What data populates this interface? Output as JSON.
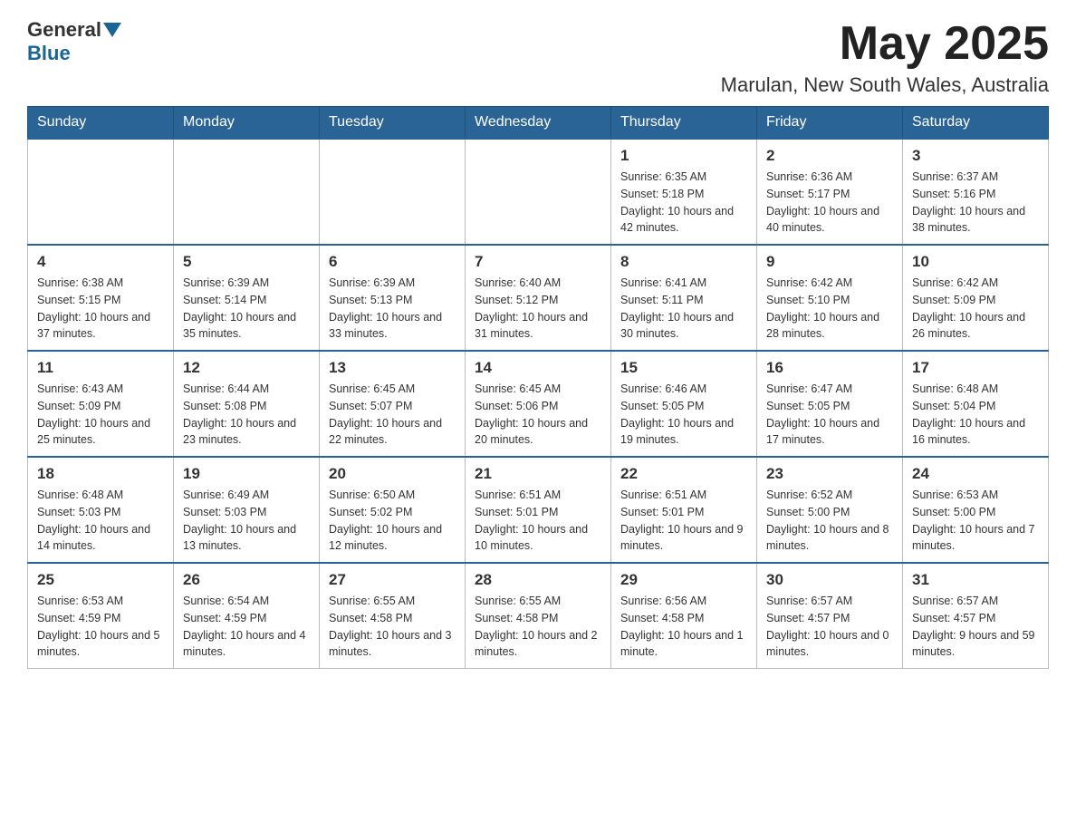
{
  "header": {
    "logo_general": "General",
    "logo_blue": "Blue",
    "month_title": "May 2025",
    "location": "Marulan, New South Wales, Australia"
  },
  "days_of_week": [
    "Sunday",
    "Monday",
    "Tuesday",
    "Wednesday",
    "Thursday",
    "Friday",
    "Saturday"
  ],
  "weeks": [
    {
      "days": [
        {
          "number": "",
          "info": ""
        },
        {
          "number": "",
          "info": ""
        },
        {
          "number": "",
          "info": ""
        },
        {
          "number": "",
          "info": ""
        },
        {
          "number": "1",
          "info": "Sunrise: 6:35 AM\nSunset: 5:18 PM\nDaylight: 10 hours and 42 minutes."
        },
        {
          "number": "2",
          "info": "Sunrise: 6:36 AM\nSunset: 5:17 PM\nDaylight: 10 hours and 40 minutes."
        },
        {
          "number": "3",
          "info": "Sunrise: 6:37 AM\nSunset: 5:16 PM\nDaylight: 10 hours and 38 minutes."
        }
      ]
    },
    {
      "days": [
        {
          "number": "4",
          "info": "Sunrise: 6:38 AM\nSunset: 5:15 PM\nDaylight: 10 hours and 37 minutes."
        },
        {
          "number": "5",
          "info": "Sunrise: 6:39 AM\nSunset: 5:14 PM\nDaylight: 10 hours and 35 minutes."
        },
        {
          "number": "6",
          "info": "Sunrise: 6:39 AM\nSunset: 5:13 PM\nDaylight: 10 hours and 33 minutes."
        },
        {
          "number": "7",
          "info": "Sunrise: 6:40 AM\nSunset: 5:12 PM\nDaylight: 10 hours and 31 minutes."
        },
        {
          "number": "8",
          "info": "Sunrise: 6:41 AM\nSunset: 5:11 PM\nDaylight: 10 hours and 30 minutes."
        },
        {
          "number": "9",
          "info": "Sunrise: 6:42 AM\nSunset: 5:10 PM\nDaylight: 10 hours and 28 minutes."
        },
        {
          "number": "10",
          "info": "Sunrise: 6:42 AM\nSunset: 5:09 PM\nDaylight: 10 hours and 26 minutes."
        }
      ]
    },
    {
      "days": [
        {
          "number": "11",
          "info": "Sunrise: 6:43 AM\nSunset: 5:09 PM\nDaylight: 10 hours and 25 minutes."
        },
        {
          "number": "12",
          "info": "Sunrise: 6:44 AM\nSunset: 5:08 PM\nDaylight: 10 hours and 23 minutes."
        },
        {
          "number": "13",
          "info": "Sunrise: 6:45 AM\nSunset: 5:07 PM\nDaylight: 10 hours and 22 minutes."
        },
        {
          "number": "14",
          "info": "Sunrise: 6:45 AM\nSunset: 5:06 PM\nDaylight: 10 hours and 20 minutes."
        },
        {
          "number": "15",
          "info": "Sunrise: 6:46 AM\nSunset: 5:05 PM\nDaylight: 10 hours and 19 minutes."
        },
        {
          "number": "16",
          "info": "Sunrise: 6:47 AM\nSunset: 5:05 PM\nDaylight: 10 hours and 17 minutes."
        },
        {
          "number": "17",
          "info": "Sunrise: 6:48 AM\nSunset: 5:04 PM\nDaylight: 10 hours and 16 minutes."
        }
      ]
    },
    {
      "days": [
        {
          "number": "18",
          "info": "Sunrise: 6:48 AM\nSunset: 5:03 PM\nDaylight: 10 hours and 14 minutes."
        },
        {
          "number": "19",
          "info": "Sunrise: 6:49 AM\nSunset: 5:03 PM\nDaylight: 10 hours and 13 minutes."
        },
        {
          "number": "20",
          "info": "Sunrise: 6:50 AM\nSunset: 5:02 PM\nDaylight: 10 hours and 12 minutes."
        },
        {
          "number": "21",
          "info": "Sunrise: 6:51 AM\nSunset: 5:01 PM\nDaylight: 10 hours and 10 minutes."
        },
        {
          "number": "22",
          "info": "Sunrise: 6:51 AM\nSunset: 5:01 PM\nDaylight: 10 hours and 9 minutes."
        },
        {
          "number": "23",
          "info": "Sunrise: 6:52 AM\nSunset: 5:00 PM\nDaylight: 10 hours and 8 minutes."
        },
        {
          "number": "24",
          "info": "Sunrise: 6:53 AM\nSunset: 5:00 PM\nDaylight: 10 hours and 7 minutes."
        }
      ]
    },
    {
      "days": [
        {
          "number": "25",
          "info": "Sunrise: 6:53 AM\nSunset: 4:59 PM\nDaylight: 10 hours and 5 minutes."
        },
        {
          "number": "26",
          "info": "Sunrise: 6:54 AM\nSunset: 4:59 PM\nDaylight: 10 hours and 4 minutes."
        },
        {
          "number": "27",
          "info": "Sunrise: 6:55 AM\nSunset: 4:58 PM\nDaylight: 10 hours and 3 minutes."
        },
        {
          "number": "28",
          "info": "Sunrise: 6:55 AM\nSunset: 4:58 PM\nDaylight: 10 hours and 2 minutes."
        },
        {
          "number": "29",
          "info": "Sunrise: 6:56 AM\nSunset: 4:58 PM\nDaylight: 10 hours and 1 minute."
        },
        {
          "number": "30",
          "info": "Sunrise: 6:57 AM\nSunset: 4:57 PM\nDaylight: 10 hours and 0 minutes."
        },
        {
          "number": "31",
          "info": "Sunrise: 6:57 AM\nSunset: 4:57 PM\nDaylight: 9 hours and 59 minutes."
        }
      ]
    }
  ]
}
